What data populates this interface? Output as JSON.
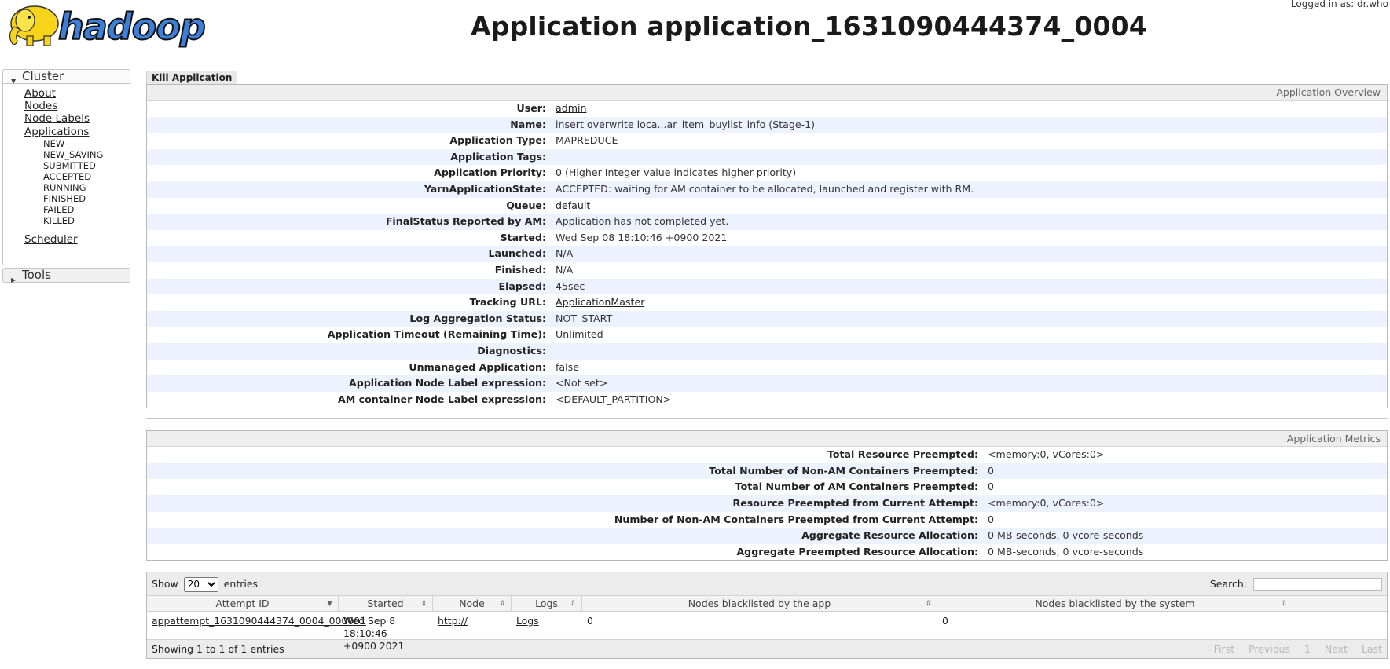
{
  "header": {
    "logged_in": "Logged in as: dr.who",
    "logo_text": "hadoop",
    "title": "Application application_1631090444374_0004"
  },
  "nav": {
    "cluster_label": "Cluster",
    "cluster_links": [
      "About",
      "Nodes",
      "Node Labels",
      "Applications"
    ],
    "app_states": [
      "NEW",
      "NEW_SAVING",
      "SUBMITTED",
      "ACCEPTED",
      "RUNNING",
      "FINISHED",
      "FAILED",
      "KILLED"
    ],
    "scheduler": "Scheduler",
    "tools_label": "Tools"
  },
  "kill_tab": "Kill Application",
  "overview": {
    "title": "Application Overview",
    "rows": [
      {
        "k": "User:",
        "v": "admin",
        "link": true
      },
      {
        "k": "Name:",
        "v": "insert overwrite loca...ar_item_buylist_info (Stage-1)",
        "link": false
      },
      {
        "k": "Application Type:",
        "v": "MAPREDUCE",
        "link": false
      },
      {
        "k": "Application Tags:",
        "v": "",
        "link": false
      },
      {
        "k": "Application Priority:",
        "v": "0 (Higher Integer value indicates higher priority)",
        "link": false
      },
      {
        "k": "YarnApplicationState:",
        "v": "ACCEPTED: waiting for AM container to be allocated, launched and register with RM.",
        "link": false
      },
      {
        "k": "Queue:",
        "v": "default",
        "link": true
      },
      {
        "k": "FinalStatus Reported by AM:",
        "v": "Application has not completed yet.",
        "link": false
      },
      {
        "k": "Started:",
        "v": "Wed Sep 08 18:10:46 +0900 2021",
        "link": false
      },
      {
        "k": "Launched:",
        "v": "N/A",
        "link": false
      },
      {
        "k": "Finished:",
        "v": "N/A",
        "link": false
      },
      {
        "k": "Elapsed:",
        "v": "45sec",
        "link": false
      },
      {
        "k": "Tracking URL:",
        "v": "ApplicationMaster",
        "link": true
      },
      {
        "k": "Log Aggregation Status:",
        "v": "NOT_START",
        "link": false
      },
      {
        "k": "Application Timeout (Remaining Time):",
        "v": "Unlimited",
        "link": false
      },
      {
        "k": "Diagnostics:",
        "v": "",
        "link": false
      },
      {
        "k": "Unmanaged Application:",
        "v": "false",
        "link": false
      },
      {
        "k": "Application Node Label expression:",
        "v": "<Not set>",
        "link": false
      },
      {
        "k": "AM container Node Label expression:",
        "v": "<DEFAULT_PARTITION>",
        "link": false
      }
    ]
  },
  "metrics": {
    "title": "Application Metrics",
    "rows": [
      {
        "k": "Total Resource Preempted:",
        "v": "<memory:0, vCores:0>"
      },
      {
        "k": "Total Number of Non-AM Containers Preempted:",
        "v": "0"
      },
      {
        "k": "Total Number of AM Containers Preempted:",
        "v": "0"
      },
      {
        "k": "Resource Preempted from Current Attempt:",
        "v": "<memory:0, vCores:0>"
      },
      {
        "k": "Number of Non-AM Containers Preempted from Current Attempt:",
        "v": "0"
      },
      {
        "k": "Aggregate Resource Allocation:",
        "v": "0 MB-seconds, 0 vcore-seconds"
      },
      {
        "k": "Aggregate Preempted Resource Allocation:",
        "v": "0 MB-seconds, 0 vcore-seconds"
      }
    ]
  },
  "attempts": {
    "show_label": "Show",
    "entries_value": "20",
    "entries_label": "entries",
    "search_label": "Search:",
    "columns": [
      "Attempt ID",
      "Started",
      "Node",
      "Logs",
      "Nodes blacklisted by the app",
      "Nodes blacklisted by the system"
    ],
    "rows": [
      {
        "attempt_id": "appattempt_1631090444374_0004_000001",
        "started_line1": "Wed Sep 8 18:10:46",
        "started_line2": "+0900 2021",
        "node": "http://",
        "logs": "Logs",
        "bl_app": "0",
        "bl_sys": "0"
      }
    ],
    "footer_info": "Showing 1 to 1 of 1 entries",
    "pager": [
      "First",
      "Previous",
      "1",
      "Next",
      "Last"
    ]
  }
}
